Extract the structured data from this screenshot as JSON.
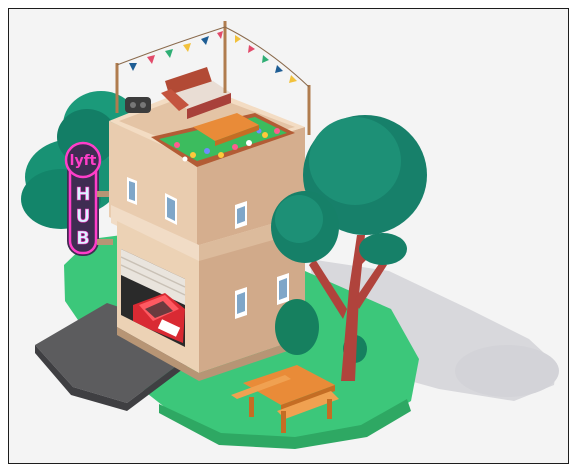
{
  "illustration": {
    "sign": {
      "brand": "lyft",
      "word": "HUB"
    },
    "colors": {
      "background": "#f4f4f4",
      "lawn": "#3cc77a",
      "building_light": "#f0d4b7",
      "building_shade": "#d4ae8f",
      "tree_foliage": "#17806a",
      "trunk": "#b0433c",
      "car": "#d92a33",
      "sign_accent": "#ff3ec9",
      "sign_panel": "#3f2c52",
      "bench_wood": "#e98b38"
    }
  }
}
